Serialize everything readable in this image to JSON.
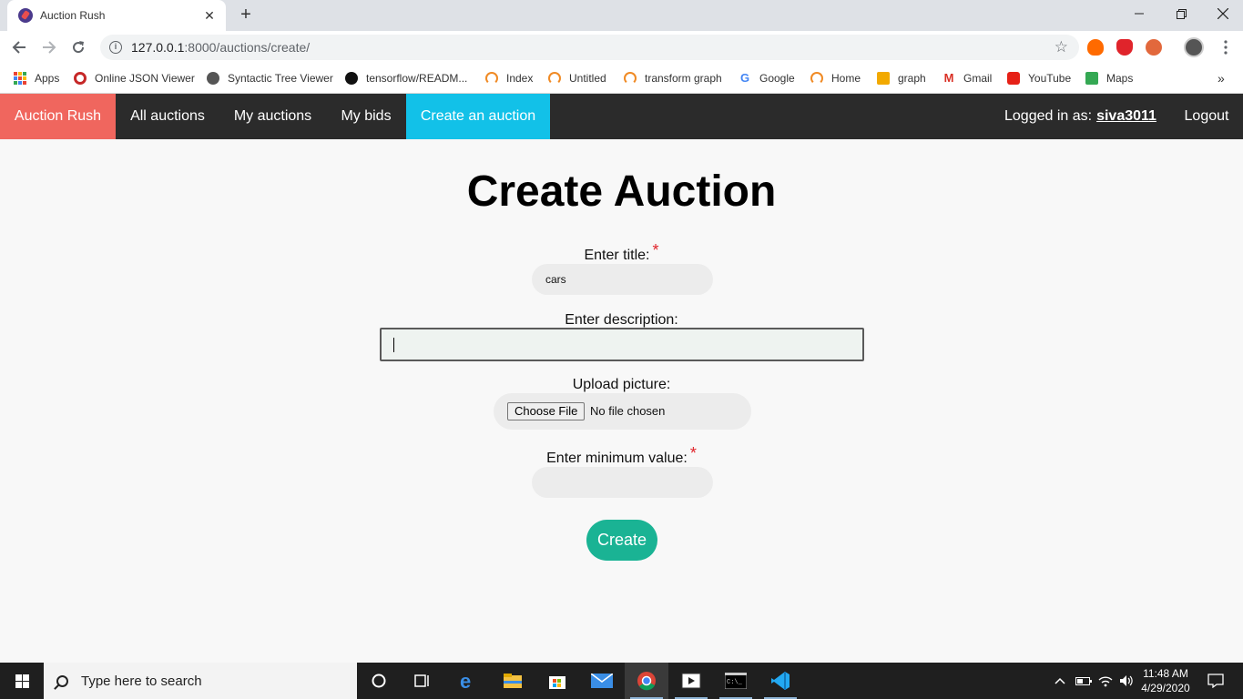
{
  "browser": {
    "tab_title": "Auction Rush",
    "tab_close": "✕",
    "new_tab": "+",
    "url_host": "127.0.0.1",
    "url_path": ":8000/auctions/create/",
    "bookmarks": [
      {
        "label": "Apps"
      },
      {
        "label": "Online JSON Viewer"
      },
      {
        "label": "Syntactic Tree Viewer"
      },
      {
        "label": "tensorflow/READM..."
      },
      {
        "label": "Index"
      },
      {
        "label": "Untitled"
      },
      {
        "label": "transform graph"
      },
      {
        "label": "Google"
      },
      {
        "label": "Home"
      },
      {
        "label": "graph"
      },
      {
        "label": "Gmail"
      },
      {
        "label": "YouTube"
      },
      {
        "label": "Maps"
      }
    ],
    "more_bookmarks": "»"
  },
  "nav": {
    "brand": "Auction Rush",
    "items": [
      "All auctions",
      "My auctions",
      "My bids",
      "Create an auction"
    ],
    "logged_in_label": "Logged in as:",
    "username": "siva3011",
    "logout": "Logout"
  },
  "form": {
    "heading": "Create Auction",
    "title_label": "Enter title:",
    "title_value": "cars",
    "description_label": "Enter description:",
    "description_value": "",
    "picture_label": "Upload picture:",
    "choose_file": "Choose File",
    "no_file": "No file chosen",
    "min_value_label": "Enter minimum value:",
    "min_value": "",
    "required_mark": "*",
    "submit": "Create"
  },
  "taskbar": {
    "search_placeholder": "Type here to search",
    "time": "11:48 AM",
    "date": "4/29/2020"
  },
  "colors": {
    "brand": "#f0665e",
    "active_nav": "#12c1e8",
    "nav_bg": "#2b2b2b",
    "create_button": "#1ab394",
    "required": "#e0242b"
  }
}
